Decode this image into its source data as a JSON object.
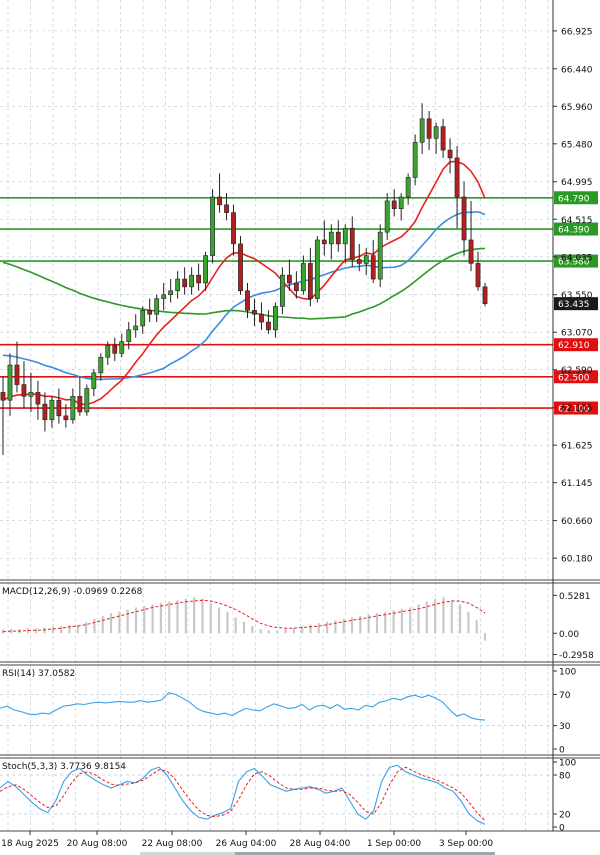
{
  "colors": {
    "up": "#3aa32f",
    "down": "#b02020",
    "ma_fast": "#e8221c",
    "ma_mid": "#3a8de0",
    "ma_slow": "#2a9a24",
    "macd_signal": "#e8221c",
    "osc_line": "#3aa0e8",
    "support": "#e01010",
    "resistance": "#2a9a24",
    "grid": "#b8c8d4",
    "price_tag": "#1a1a1a"
  },
  "chart_data": [
    {
      "type": "candlestick",
      "panel": "price",
      "y_ticks": [
        "66.925",
        "66.440",
        "65.960",
        "65.480",
        "64.995",
        "64.515",
        "64.035",
        "63.550",
        "63.070",
        "62.590",
        "62.105",
        "61.625",
        "61.145",
        "60.660",
        "60.180"
      ],
      "ylim": [
        59.9,
        67.32
      ],
      "x_ticks": [
        "18 Aug 2025",
        "20 Aug 08:00",
        "22 Aug 08:00",
        "26 Aug 04:00",
        "28 Aug 04:00",
        "1 Sep 00:00",
        "3 Sep 00:00"
      ],
      "horizontal_levels": [
        {
          "value": 64.79,
          "label": "64.790",
          "kind": "resistance"
        },
        {
          "value": 64.39,
          "label": "64.390",
          "kind": "resistance"
        },
        {
          "value": 63.98,
          "label": "63.980",
          "kind": "resistance"
        },
        {
          "value": 62.91,
          "label": "62.910",
          "kind": "support"
        },
        {
          "value": 62.5,
          "label": "62.500",
          "kind": "support"
        },
        {
          "value": 62.1,
          "label": "62.100",
          "kind": "support"
        }
      ],
      "current_price": "63.435",
      "candles": [
        [
          62.3,
          62.5,
          61.5,
          62.2
        ],
        [
          62.2,
          62.8,
          62.0,
          62.65
        ],
        [
          62.65,
          62.95,
          62.3,
          62.4
        ],
        [
          62.4,
          62.7,
          62.1,
          62.25
        ],
        [
          62.25,
          62.55,
          62.05,
          62.3
        ],
        [
          62.3,
          62.45,
          61.95,
          62.15
        ],
        [
          62.15,
          62.3,
          61.8,
          61.95
        ],
        [
          61.95,
          62.25,
          61.85,
          62.2
        ],
        [
          62.2,
          62.35,
          61.9,
          62.0
        ],
        [
          62.0,
          62.15,
          61.85,
          61.95
        ],
        [
          61.95,
          62.35,
          61.9,
          62.25
        ],
        [
          62.25,
          62.5,
          62.0,
          62.05
        ],
        [
          62.05,
          62.4,
          62.0,
          62.35
        ],
        [
          62.35,
          62.6,
          62.25,
          62.55
        ],
        [
          62.55,
          62.8,
          62.45,
          62.75
        ],
        [
          62.75,
          62.95,
          62.65,
          62.9
        ],
        [
          62.9,
          63.0,
          62.7,
          62.8
        ],
        [
          62.8,
          63.05,
          62.75,
          62.95
        ],
        [
          62.95,
          63.2,
          62.85,
          63.1
        ],
        [
          63.1,
          63.3,
          63.0,
          63.15
        ],
        [
          63.15,
          63.4,
          63.05,
          63.35
        ],
        [
          63.35,
          63.5,
          63.2,
          63.3
        ],
        [
          63.3,
          63.55,
          63.2,
          63.5
        ],
        [
          63.5,
          63.7,
          63.35,
          63.55
        ],
        [
          63.55,
          63.75,
          63.45,
          63.6
        ],
        [
          63.6,
          63.85,
          63.5,
          63.75
        ],
        [
          63.75,
          63.9,
          63.55,
          63.65
        ],
        [
          63.65,
          63.9,
          63.55,
          63.8
        ],
        [
          63.8,
          63.95,
          63.6,
          63.7
        ],
        [
          63.7,
          64.1,
          63.6,
          64.05
        ],
        [
          64.05,
          64.9,
          63.95,
          64.8
        ],
        [
          64.8,
          65.1,
          64.6,
          64.7
        ],
        [
          64.7,
          64.85,
          64.5,
          64.6
        ],
        [
          64.6,
          64.7,
          64.05,
          64.2
        ],
        [
          64.2,
          64.3,
          63.55,
          63.6
        ],
        [
          63.6,
          63.7,
          63.25,
          63.35
        ],
        [
          63.35,
          63.5,
          63.15,
          63.3
        ],
        [
          63.3,
          63.45,
          63.1,
          63.2
        ],
        [
          63.2,
          63.35,
          63.05,
          63.1
        ],
        [
          63.1,
          63.45,
          63.0,
          63.4
        ],
        [
          63.4,
          63.9,
          63.3,
          63.8
        ],
        [
          63.8,
          64.0,
          63.6,
          63.7
        ],
        [
          63.7,
          63.85,
          63.5,
          63.6
        ],
        [
          63.6,
          64.05,
          63.55,
          63.95
        ],
        [
          63.95,
          64.15,
          63.4,
          63.5
        ],
        [
          63.5,
          64.3,
          63.45,
          64.25
        ],
        [
          64.25,
          64.5,
          64.05,
          64.2
        ],
        [
          64.2,
          64.45,
          64.0,
          64.35
        ],
        [
          64.35,
          64.5,
          64.1,
          64.2
        ],
        [
          64.2,
          64.45,
          63.95,
          64.4
        ],
        [
          64.4,
          64.55,
          63.9,
          64.0
        ],
        [
          64.0,
          64.2,
          63.85,
          63.95
        ],
        [
          63.95,
          64.15,
          63.8,
          64.05
        ],
        [
          64.05,
          64.25,
          63.7,
          63.75
        ],
        [
          63.75,
          64.45,
          63.65,
          64.35
        ],
        [
          64.35,
          64.85,
          64.25,
          64.75
        ],
        [
          64.75,
          64.9,
          64.55,
          64.65
        ],
        [
          64.65,
          64.85,
          64.5,
          64.8
        ],
        [
          64.8,
          65.1,
          64.7,
          65.05
        ],
        [
          65.05,
          65.6,
          64.95,
          65.5
        ],
        [
          65.5,
          66.0,
          65.35,
          65.8
        ],
        [
          65.8,
          65.9,
          65.4,
          65.55
        ],
        [
          65.55,
          65.75,
          65.35,
          65.7
        ],
        [
          65.7,
          65.8,
          65.3,
          65.4
        ],
        [
          65.4,
          65.55,
          65.1,
          65.3
        ],
        [
          65.3,
          65.45,
          64.4,
          64.8
        ],
        [
          64.8,
          65.0,
          64.05,
          64.25
        ],
        [
          64.25,
          64.75,
          63.85,
          63.95
        ],
        [
          63.95,
          64.1,
          63.6,
          63.65
        ],
        [
          63.65,
          63.7,
          63.4,
          63.435
        ]
      ]
    },
    {
      "type": "bar",
      "panel": "macd",
      "title": "MACD(12,26,9) -0.0969 0.2268",
      "y_ticks": [
        "0.5281",
        "0.00",
        "-0.2958"
      ],
      "ylim": [
        -0.4,
        0.7
      ],
      "histogram": [
        0.05,
        0.06,
        0.06,
        0.07,
        0.07,
        0.08,
        0.09,
        0.1,
        0.11,
        0.12,
        0.15,
        0.2,
        0.24,
        0.28,
        0.3,
        0.33,
        0.36,
        0.38,
        0.4,
        0.42,
        0.44,
        0.46,
        0.48,
        0.5,
        0.48,
        0.42,
        0.36,
        0.3,
        0.22,
        0.16,
        0.1,
        0.06,
        0.04,
        0.04,
        0.06,
        0.08,
        0.1,
        0.12,
        0.14,
        0.16,
        0.18,
        0.2,
        0.22,
        0.24,
        0.26,
        0.28,
        0.3,
        0.32,
        0.34,
        0.36,
        0.4,
        0.44,
        0.48,
        0.5,
        0.46,
        0.4,
        0.3,
        0.18,
        -0.1
      ],
      "signal": [
        0.02,
        0.03,
        0.03,
        0.04,
        0.04,
        0.05,
        0.06,
        0.07,
        0.09,
        0.1,
        0.12,
        0.15,
        0.18,
        0.21,
        0.24,
        0.27,
        0.3,
        0.33,
        0.36,
        0.38,
        0.4,
        0.42,
        0.44,
        0.45,
        0.46,
        0.45,
        0.42,
        0.38,
        0.33,
        0.27,
        0.2,
        0.14,
        0.1,
        0.08,
        0.07,
        0.07,
        0.08,
        0.09,
        0.1,
        0.12,
        0.14,
        0.16,
        0.18,
        0.2,
        0.22,
        0.24,
        0.26,
        0.28,
        0.3,
        0.32,
        0.34,
        0.37,
        0.4,
        0.43,
        0.45,
        0.45,
        0.42,
        0.36,
        0.28
      ]
    },
    {
      "type": "line",
      "panel": "rsi",
      "title": "RSI(14) 37.0582",
      "y_ticks": [
        "100",
        "70",
        "30",
        "0"
      ],
      "ylim": [
        0,
        100
      ],
      "values": [
        52,
        55,
        50,
        48,
        45,
        44,
        46,
        45,
        50,
        55,
        56,
        58,
        57,
        59,
        60,
        59,
        60,
        61,
        60,
        60,
        62,
        60,
        61,
        63,
        72,
        70,
        65,
        60,
        52,
        48,
        46,
        44,
        46,
        43,
        48,
        52,
        50,
        49,
        54,
        58,
        55,
        52,
        53,
        57,
        50,
        55,
        56,
        52,
        57,
        51,
        52,
        50,
        56,
        54,
        60,
        62,
        65,
        63,
        67,
        69,
        66,
        69,
        65,
        60,
        50,
        42,
        45,
        40,
        38,
        37
      ]
    },
    {
      "type": "line",
      "panel": "stoch",
      "title": "Stoch(5,3,3) 3.7736 9.8154",
      "y_ticks": [
        "100",
        "80",
        "20",
        "0"
      ],
      "ylim": [
        0,
        100
      ],
      "main": [
        60,
        70,
        62,
        50,
        38,
        28,
        22,
        40,
        70,
        85,
        90,
        80,
        72,
        65,
        60,
        65,
        70,
        68,
        75,
        88,
        92,
        80,
        60,
        40,
        25,
        15,
        12,
        18,
        22,
        28,
        70,
        85,
        90,
        78,
        65,
        60,
        55,
        58,
        60,
        62,
        58,
        52,
        55,
        60,
        40,
        20,
        12,
        25,
        70,
        92,
        95,
        85,
        80,
        75,
        72,
        68,
        60,
        55,
        40,
        20,
        10,
        4
      ],
      "signal": [
        55,
        62,
        65,
        58,
        48,
        38,
        30,
        32,
        48,
        68,
        82,
        85,
        80,
        72,
        66,
        64,
        66,
        68,
        72,
        80,
        88,
        86,
        74,
        56,
        40,
        26,
        18,
        16,
        18,
        24,
        42,
        65,
        82,
        85,
        78,
        68,
        60,
        58,
        58,
        60,
        60,
        57,
        55,
        56,
        50,
        38,
        24,
        20,
        38,
        65,
        85,
        92,
        86,
        80,
        76,
        72,
        66,
        60,
        52,
        38,
        22,
        10
      ]
    }
  ]
}
